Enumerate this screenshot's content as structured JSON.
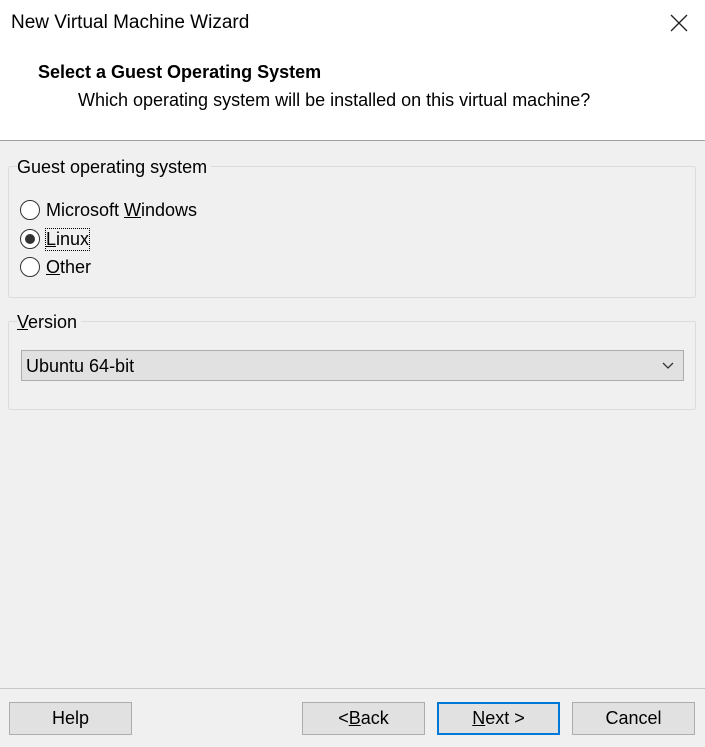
{
  "window": {
    "title": "New Virtual Machine Wizard"
  },
  "header": {
    "title": "Select a Guest Operating System",
    "subtitle": "Which operating system will be installed on this virtual machine?"
  },
  "guest_os": {
    "group_label": "Guest operating system",
    "options": [
      {
        "label_pre": "Microsoft ",
        "accel": "W",
        "label_post": "indows",
        "selected": false
      },
      {
        "label_pre": "",
        "accel": "L",
        "label_post": "inux",
        "selected": true
      },
      {
        "label_pre": "",
        "accel": "O",
        "label_post": "ther",
        "selected": false
      }
    ]
  },
  "version": {
    "group_label_accel": "V",
    "group_label_rest": "ersion",
    "selected": "Ubuntu 64-bit"
  },
  "buttons": {
    "help": "Help",
    "back_pre": "< ",
    "back_accel": "B",
    "back_post": "ack",
    "next_accel": "N",
    "next_post": "ext >",
    "cancel": "Cancel"
  }
}
